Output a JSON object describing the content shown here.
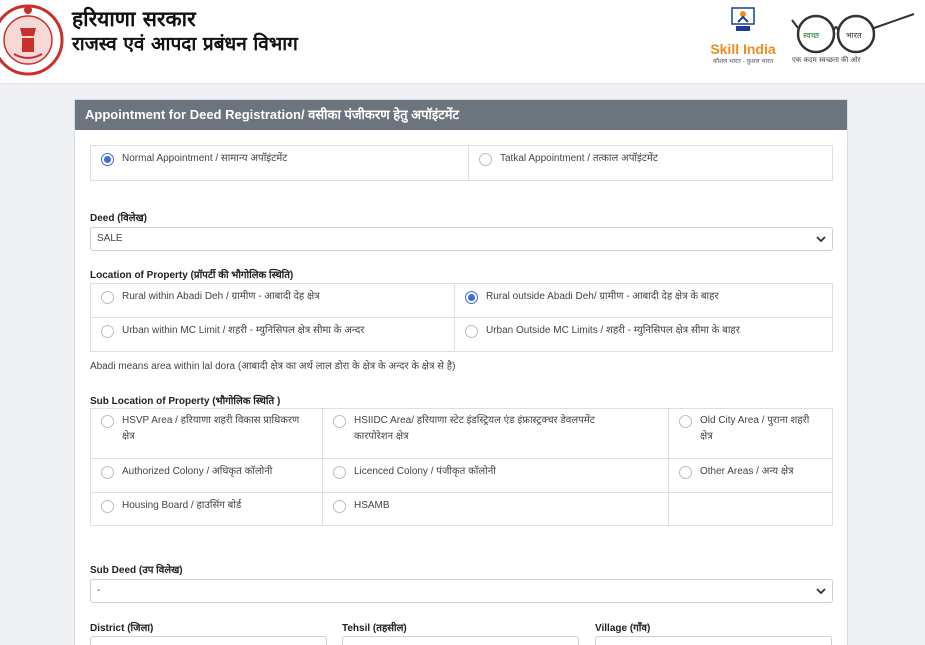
{
  "header": {
    "title_line1": "हरियाणा सरकार",
    "title_line2": "राजस्व एवं आपदा प्रबंधन विभाग",
    "skill_logo_text": "Skill India",
    "skill_logo_sub": "कौशल भारत - कुशल भारत",
    "swachh_logo_text": "स्वच्छ",
    "swachh_logo_text2": "भारत",
    "swachh_tagline": "एक कदम स्वच्छता की ओर"
  },
  "card": {
    "title": "Appointment for Deed Registration/ वसीका पंजीकरण हेतु अपॉइंटमेंट"
  },
  "appointment_type": {
    "options": [
      {
        "label": "Normal Appointment / सामान्य अपॉइंटमेंट",
        "selected": true
      },
      {
        "label": "Tatkal Appointment / तत्काल अपॉइंटमेंट",
        "selected": false
      }
    ]
  },
  "deed": {
    "label": "Deed (विलेख)",
    "value": "SALE"
  },
  "location": {
    "label": "Location of Property (प्रॉपर्टी की भौगोलिक स्थिति)",
    "options": [
      {
        "label": "Rural within Abadi Deh / ग्रामीण - आबादी देह क्षेत्र",
        "selected": false
      },
      {
        "label": "Rural outside Abadi Deh/ ग्रामीण - आबादी देह क्षेत्र के बाहर",
        "selected": true
      },
      {
        "label": "Urban within MC Limit / शहरी - म्युनिसिपल क्षेत्र सीमा के अन्दर",
        "selected": false
      },
      {
        "label": "Urban Outside MC Limits / शहरी - म्युनिसिपल क्षेत्र सीमा के बाहर",
        "selected": false
      }
    ],
    "note": "Abadi means area within lal dora (आबादी क्षेत्र का अर्थ लाल डोरा के क्षेत्र के अन्दर के क्षेत्र से है)"
  },
  "sub_location": {
    "label": "Sub Location of Property (भौगोलिक स्थिति )",
    "options": [
      {
        "line1": "HSVP Area / हरियाणा शहरी विकास प्राधिकरण",
        "line2": "क्षेत्र",
        "selected": false
      },
      {
        "line1": "HSIIDC Area/ हरियाणा स्टेट इंडस्ट्रियल एंड इंफ्रास्ट्रक्चर डेवलपमेंट",
        "line2": "कारपोरेशन क्षेत्र",
        "selected": false
      },
      {
        "line1": "Old City Area / पुराना शहरी",
        "line2": "क्षेत्र",
        "selected": false
      },
      {
        "line1": "Authorized Colony / अधिकृत कॉलोनी",
        "line2": "",
        "selected": false
      },
      {
        "line1": "Licenced Colony / पंजीकृत कॉलोनी",
        "line2": "",
        "selected": false
      },
      {
        "line1": "Other Areas / अन्य क्षेत्र",
        "line2": "",
        "selected": false
      },
      {
        "line1": "Housing Board / हाउसिंग बोर्ड",
        "line2": "",
        "selected": false
      },
      {
        "line1": "HSAMB",
        "line2": "",
        "selected": false
      }
    ]
  },
  "sub_deed": {
    "label": "Sub Deed (उप विलेख)",
    "value": "-"
  },
  "district": {
    "label": "District (जिला)"
  },
  "tehsil": {
    "label": "Tehsil (तहसील)"
  },
  "village": {
    "label": "Village (गाँव)"
  },
  "colors": {
    "header_bar": "#6c757d",
    "radio_selected": "#3b6fd8",
    "page_bg": "#eef0f3"
  }
}
